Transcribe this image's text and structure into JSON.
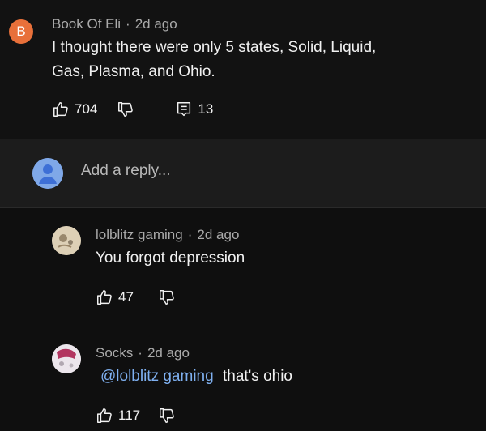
{
  "top_comment": {
    "avatar_letter": "B",
    "author": "Book Of Eli",
    "time": "2d ago",
    "text_line1": "I thought there were only 5 states, Solid, Liquid,",
    "text_line2": "Gas, Plasma, and Ohio.",
    "likes": "704",
    "replies_count": "13"
  },
  "reply_box": {
    "placeholder": "Add a reply..."
  },
  "replies": [
    {
      "author": "lolblitz gaming",
      "time": "2d ago",
      "text": "You forgot depression",
      "likes": "47"
    },
    {
      "author": "Socks",
      "time": "2d ago",
      "mention": "@lolblitz gaming",
      "text": "that's ohio",
      "likes": "117"
    }
  ],
  "separator": "·"
}
